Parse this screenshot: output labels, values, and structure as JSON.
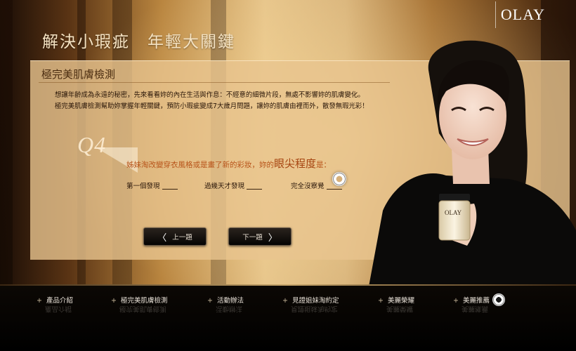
{
  "brand": {
    "logo": "OLAY"
  },
  "headline": "解決小瑕疵　年輕大關鍵",
  "section_title": "極完美肌膚檢測",
  "intro_lines": [
    "想讓年齡成為永遠的秘密，先來看看妳的內在生活與作息：不經意的細微片段，無處不影響妳的肌膚變化。",
    "極完美肌膚檢測幫助妳掌握年輕關鍵，預防小瑕疵變成7大歲月問題，讓妳的肌膚由裡而外，散發無瑕光彩！"
  ],
  "question": {
    "number": "Q4",
    "text_before": "姊妹淘改變穿衣風格或是畫了新的彩妝，妳的",
    "text_highlight": "眼尖程度",
    "text_after": "是："
  },
  "options": [
    {
      "label": "第一個發現"
    },
    {
      "label": "過幾天才發現"
    },
    {
      "label": "完全沒察覺"
    }
  ],
  "nav": {
    "prev_label": "上一題",
    "next_label": "下一題"
  },
  "product": {
    "label": "OLAY"
  },
  "menu": [
    {
      "label": "產品介紹"
    },
    {
      "label": "極完美肌膚檢測"
    },
    {
      "label": "活動辦法"
    },
    {
      "label": "見證姐妹淘約定"
    },
    {
      "label": "美麗榮耀"
    },
    {
      "label": "美麗推薦"
    }
  ]
}
